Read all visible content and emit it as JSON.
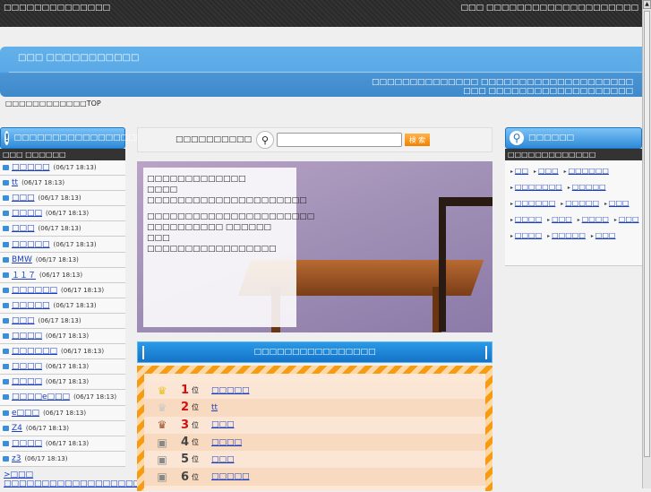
{
  "header": {
    "site_title": "□□□□□□□□□□□□□□",
    "right_text": "□□□ □□□□□□□□□□□□□□□□□□□□"
  },
  "banner": {
    "title": "□□□ □□□□□□□□□□□",
    "desc_line1": "□□□□□□□□□□□□□□ □□□□□□□□□□□□□□□□□□□□",
    "desc_line2": "□□□ □□□□□□□□□□□□□□□□□□□"
  },
  "breadcrumb": "□□□□□□□□□□□□TOP",
  "left": {
    "title": "□□□□□□□□□□□□□□□□□",
    "subtitle": "□□□ □□□□□□",
    "items": [
      {
        "label": "□□□□□",
        "time": "(06/17 18:13)"
      },
      {
        "label": "tt",
        "time": "(06/17 18:13)"
      },
      {
        "label": "□□□",
        "time": "(06/17 18:13)"
      },
      {
        "label": "□□□□",
        "time": "(06/17 18:13)"
      },
      {
        "label": "□□□",
        "time": "(06/17 18:13)"
      },
      {
        "label": "□□□□□",
        "time": "(06/17 18:13)"
      },
      {
        "label": "BMW",
        "time": "(06/17 18:13)"
      },
      {
        "label": "１１７",
        "time": "(06/17 18:13)"
      },
      {
        "label": "□□□□□□",
        "time": "(06/17 18:13)"
      },
      {
        "label": "□□□□□",
        "time": "(06/17 18:13)"
      },
      {
        "label": "□□□",
        "time": "(06/17 18:13)"
      },
      {
        "label": "□□□□",
        "time": "(06/17 18:13)"
      },
      {
        "label": "□□□□□□",
        "time": "(06/17 18:13)"
      },
      {
        "label": "□□□□",
        "time": "(06/17 18:13)"
      },
      {
        "label": "□□□□",
        "time": "(06/17 18:13)"
      },
      {
        "label": "□□□□e□□□",
        "time": "(06/17 18:13)"
      },
      {
        "label": "e□□□",
        "time": "(06/17 18:13)"
      },
      {
        "label": "Z4",
        "time": "(06/17 18:13)"
      },
      {
        "label": "□□□□",
        "time": "(06/17 18:13)"
      },
      {
        "label": "z3",
        "time": "(06/17 18:13)"
      }
    ],
    "more_link": ">□□□ □□□□□□□□□□□□□□□□□□□□□□"
  },
  "search": {
    "label": "□□□□□□□□□□",
    "button": "検 索",
    "value": ""
  },
  "hero": {
    "title": "□□□□□□□□□□□□□",
    "line1": "□□□□ □□□□□□□□□□□□□□□□□□□□□",
    "line2": "□□□□□□□□□□□□□□□□□□□□□□ □□□□□□□□□□ □□□□□□",
    "line3": "□□□ □□□□□□□□□□□□□□□□□"
  },
  "ranking": {
    "title": "□□□□□□□□□□□□□□□□",
    "rows": [
      {
        "rank": "1",
        "suffix": "位",
        "label": "□□□□□",
        "color": "#d01010",
        "icon": "gold-crown"
      },
      {
        "rank": "2",
        "suffix": "位",
        "label": "tt",
        "color": "#d01010",
        "icon": "silver-crown"
      },
      {
        "rank": "3",
        "suffix": "位",
        "label": "□□□",
        "color": "#d01010",
        "icon": "bronze-crown"
      },
      {
        "rank": "4",
        "suffix": "位",
        "label": "□□□□",
        "color": "#444444",
        "icon": "bullet"
      },
      {
        "rank": "5",
        "suffix": "位",
        "label": "□□□",
        "color": "#444444",
        "icon": "bullet"
      },
      {
        "rank": "6",
        "suffix": "位",
        "label": "□□□□□",
        "color": "#444444",
        "icon": "bullet"
      }
    ]
  },
  "right": {
    "title": "□□□□□□",
    "subtitle": "□□□□□□□□□□□□□",
    "tags": [
      "□□",
      "□□□",
      "□□□□□□",
      "□□□□□□□",
      "□□□□□",
      "□□□□□□",
      "□□□□□",
      "□□□",
      "□□□□",
      "□□□",
      "□□□□",
      "□□□",
      "□□□□",
      "□□□□□",
      "□□□"
    ]
  }
}
